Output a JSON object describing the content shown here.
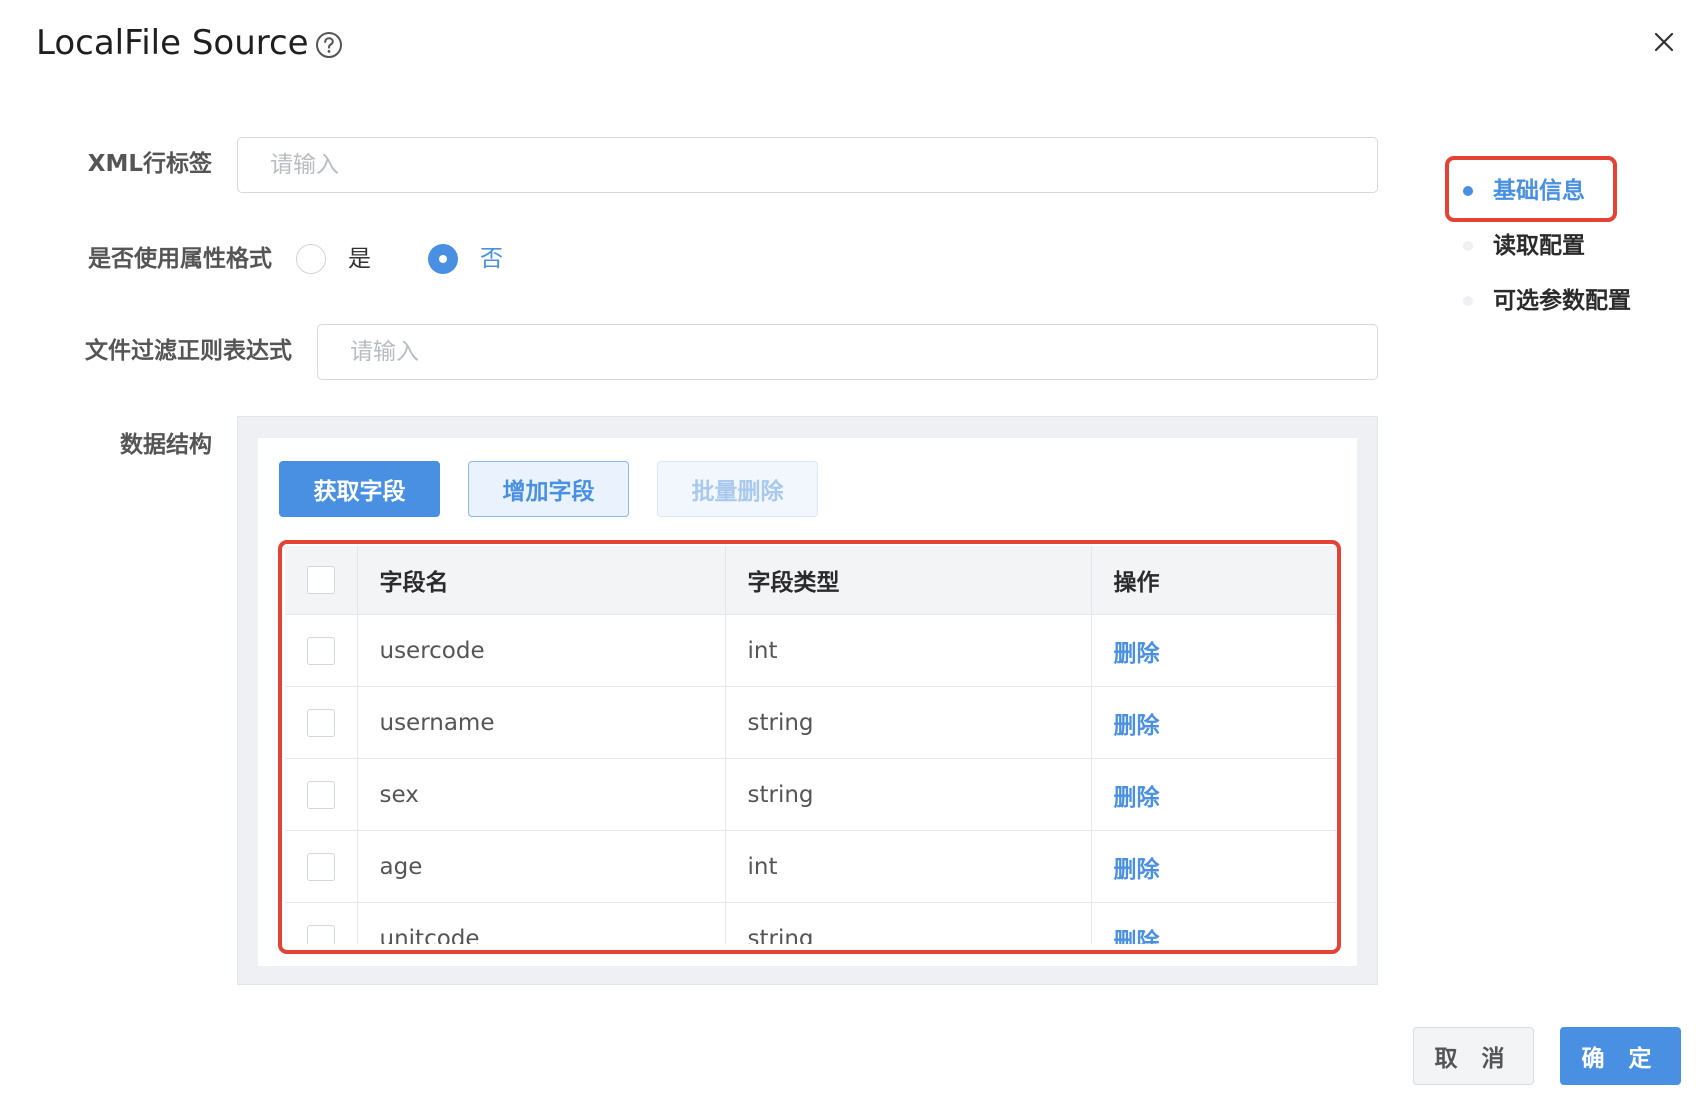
{
  "dialog": {
    "title": "LocalFile Source"
  },
  "form": {
    "xml_tag": {
      "label": "XML行标签",
      "placeholder": "请输入",
      "value": ""
    },
    "attr_format": {
      "label": "是否使用属性格式",
      "options": [
        {
          "label": "是",
          "checked": false
        },
        {
          "label": "否",
          "checked": true
        }
      ]
    },
    "file_filter": {
      "label": "文件过滤正则表达式",
      "placeholder": "请输入",
      "value": ""
    },
    "data_structure": {
      "label": "数据结构",
      "buttons": {
        "fetch": "获取字段",
        "add": "增加字段",
        "batch_delete": "批量删除"
      },
      "table": {
        "headers": {
          "name": "字段名",
          "type": "字段类型",
          "action": "操作"
        },
        "rows": [
          {
            "name": "usercode",
            "type": "int",
            "action": "删除"
          },
          {
            "name": "username",
            "type": "string",
            "action": "删除"
          },
          {
            "name": "sex",
            "type": "string",
            "action": "删除"
          },
          {
            "name": "age",
            "type": "int",
            "action": "删除"
          },
          {
            "name": "unitcode",
            "type": "string",
            "action": "删除"
          }
        ]
      }
    }
  },
  "anchor_nav": {
    "items": [
      {
        "label": "基础信息",
        "active": true
      },
      {
        "label": "读取配置",
        "active": false
      },
      {
        "label": "可选参数配置",
        "active": false
      }
    ]
  },
  "footer": {
    "cancel": "取 消",
    "confirm": "确 定"
  },
  "icons": {
    "help": "question-circle-icon",
    "close": "close-icon"
  },
  "colors": {
    "primary": "#4a90e2",
    "annotation": "#e34234"
  }
}
